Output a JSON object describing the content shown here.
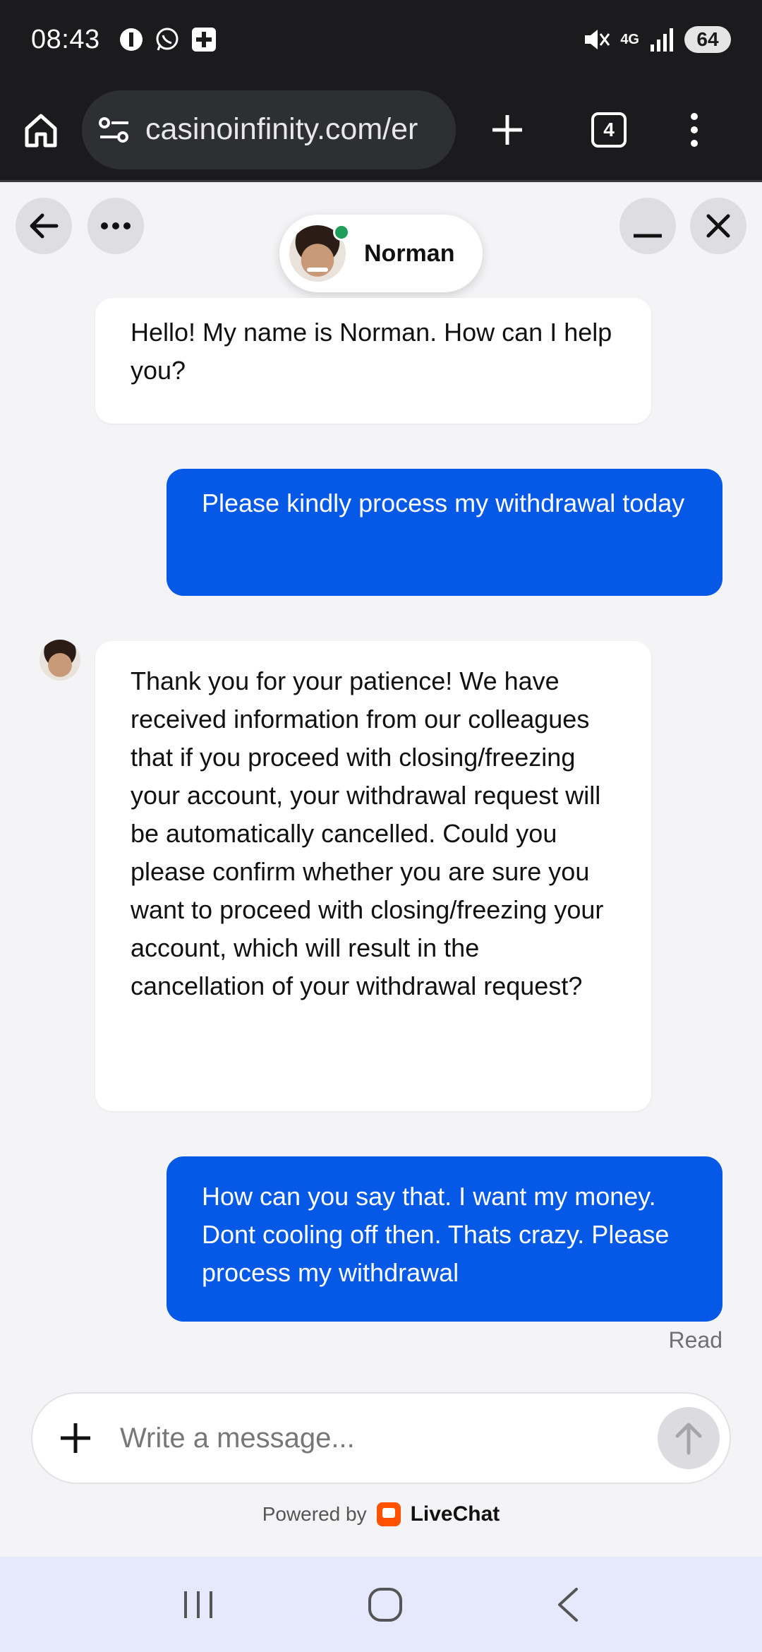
{
  "status_bar": {
    "time": "08:43",
    "network": "4G",
    "battery": "64"
  },
  "browser": {
    "url": "casinoinfinity.com/er",
    "tab_count": "4"
  },
  "chat": {
    "agent_name": "Norman",
    "messages": [
      {
        "from": "agent",
        "text": "Hello! My name is Norman. How can I help you?"
      },
      {
        "from": "user",
        "text": "Please kindly process my withdrawal today"
      },
      {
        "from": "agent",
        "text": "Thank you for your patience! We have received information from our colleagues that if you proceed with closing/freezing your account, your withdrawal request will be automatically cancelled. Could you please confirm whether you are sure you want to proceed with closing/freezing your account, which will result in the cancellation of your withdrawal request?"
      },
      {
        "from": "user",
        "text": "How can you say that. I want my money. Dont cooling off then. Thats crazy. Please process my withdrawal"
      }
    ],
    "read_receipt": "Read"
  },
  "composer": {
    "placeholder": "Write a message..."
  },
  "footer": {
    "powered_by": "Powered by",
    "brand": "LiveChat"
  },
  "colors": {
    "user_bubble": "#0559e6",
    "online": "#1f9e5a",
    "livechat_brand": "#ff5100"
  }
}
